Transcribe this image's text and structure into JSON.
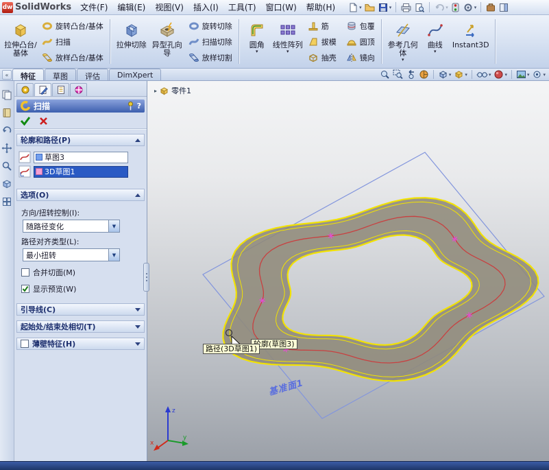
{
  "titlebar": {
    "logo_badge": "dw",
    "logo_text": "SolidWorks",
    "menus": {
      "file": "文件(F)",
      "edit": "编辑(E)",
      "view": "视图(V)",
      "insert": "插入(I)",
      "tools": "工具(T)",
      "window": "窗口(W)",
      "help": "帮助(H)"
    }
  },
  "ribbon": {
    "extrude_boss": "拉伸凸台/基体",
    "revolve_boss": "旋转凸台/基体",
    "sweep": "扫描",
    "loft_boss": "放样凸台/基体",
    "extrude_cut": "拉伸切除",
    "hole_wizard": "异型孔向导",
    "revolve_cut": "旋转切除",
    "sweep_cut": "扫描切除",
    "loft_cut": "放样切割",
    "fillet": "圆角",
    "linear_pattern": "线性阵列",
    "rib": "筋",
    "draft": "拔模",
    "shell": "抽壳",
    "wrap": "包覆",
    "dome": "圆顶",
    "mirror": "镜向",
    "reference_geometry": "参考几何体",
    "curves": "曲线",
    "instant3d": "Instant3D"
  },
  "tabs": {
    "features": "特征",
    "sketch": "草图",
    "evaluate": "评估",
    "dimxpert": "DimXpert"
  },
  "panel": {
    "title": "扫描",
    "help": "?",
    "sections": {
      "profile_path": "轮廓和路径(P)",
      "options": "选项(O)",
      "guide_curves": "引导线(C)",
      "start_end_tangency": "起始处/结束处相切(T)",
      "thin_feature": "薄壁特征(H)"
    },
    "profile_value": "草图3",
    "path_value": "3D草图1",
    "orientation_label": "方向/扭转控制(I):",
    "orientation_value": "随路径变化",
    "path_alignment_label": "路径对齐类型(L):",
    "path_alignment_value": "最小扭转",
    "merge_tangent_label": "合并切面(M)",
    "show_preview_label": "显示预览(W)"
  },
  "viewport": {
    "part_name": "零件1",
    "plane_name": "基准面1",
    "path_callout": "路径(3D草图1)",
    "profile_callout": "轮廓(草图3)"
  },
  "triad": {
    "x": "x",
    "y": "y",
    "z": "z"
  },
  "glyphs": {
    "dropdown_arrow": "▼",
    "menu_arrow": "▾",
    "chevrons": "»"
  },
  "colors": {
    "preview_edge": "#f2e202",
    "preview_face": "#8f8a7a",
    "path_line": "#c84040",
    "marker": "#e44cd0",
    "plane_edge": "#8295dd",
    "selection_blue": "#2a5ac4",
    "statusbar_blue": "#27457e"
  }
}
